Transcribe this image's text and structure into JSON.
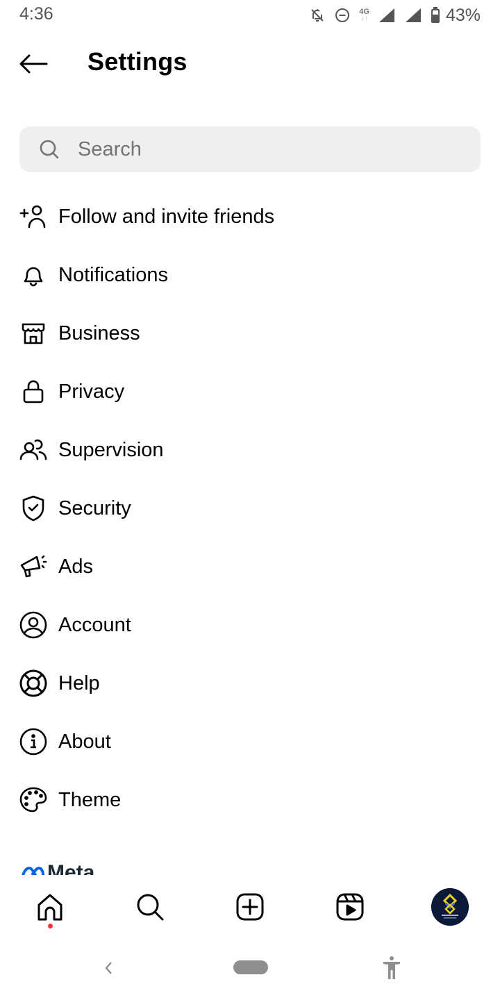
{
  "status_bar": {
    "time": "4:36",
    "network_type": "4G",
    "battery_percent": "43%",
    "icons": [
      "notifications-off-icon",
      "do-not-disturb-icon",
      "network-4g-icon",
      "signal-icon",
      "signal-icon",
      "battery-icon"
    ]
  },
  "header": {
    "back_icon": "arrow-left-icon",
    "title": "Settings"
  },
  "search": {
    "placeholder": "Search",
    "value": "",
    "icon": "search-icon"
  },
  "menu": {
    "items": [
      {
        "label": "Follow and invite friends",
        "icon": "add-person-icon"
      },
      {
        "label": "Notifications",
        "icon": "bell-icon"
      },
      {
        "label": "Business",
        "icon": "storefront-icon"
      },
      {
        "label": "Privacy",
        "icon": "lock-icon"
      },
      {
        "label": "Supervision",
        "icon": "people-icon"
      },
      {
        "label": "Security",
        "icon": "shield-check-icon"
      },
      {
        "label": "Ads",
        "icon": "megaphone-icon"
      },
      {
        "label": "Account",
        "icon": "account-circle-icon"
      },
      {
        "label": "Help",
        "icon": "lifebuoy-icon"
      },
      {
        "label": "About",
        "icon": "info-icon"
      },
      {
        "label": "Theme",
        "icon": "palette-icon"
      }
    ]
  },
  "footer": {
    "brand": "Meta",
    "brand_color": "#0668e1"
  },
  "tab_bar": {
    "tabs": [
      {
        "name": "home",
        "icon": "home-icon",
        "active": true,
        "has_notification_dot": true
      },
      {
        "name": "search",
        "icon": "search-icon"
      },
      {
        "name": "create",
        "icon": "plus-square-icon"
      },
      {
        "name": "reels",
        "icon": "reels-icon"
      },
      {
        "name": "profile",
        "icon": "profile-avatar"
      }
    ],
    "notification_dot_color": "#ff3040"
  },
  "system_nav": {
    "buttons": [
      "back-icon",
      "home-pill",
      "accessibility-icon"
    ]
  }
}
